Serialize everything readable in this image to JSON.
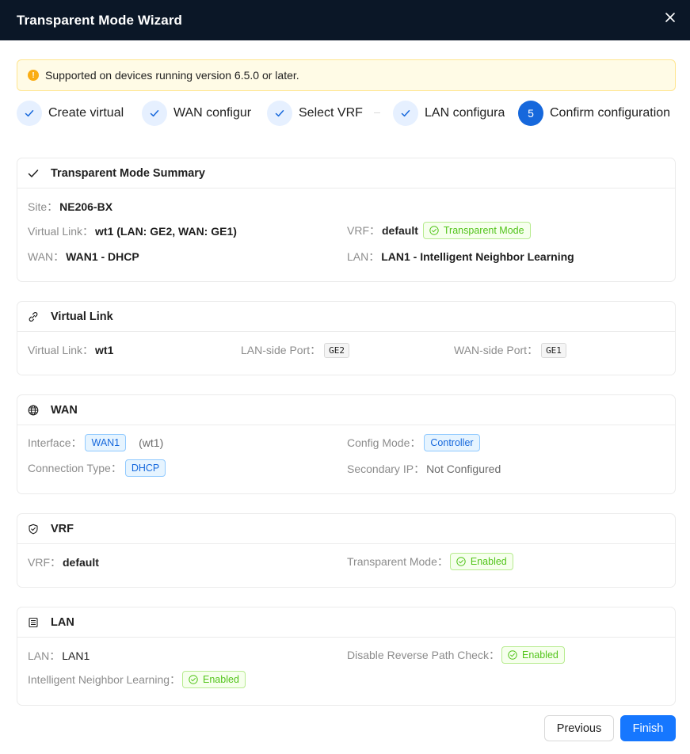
{
  "modal": {
    "title": "Transparent Mode Wizard"
  },
  "alert": {
    "text": "Supported on devices running version 6.5.0 or later."
  },
  "steps": [
    {
      "label": "Create virtual"
    },
    {
      "label": "WAN configur"
    },
    {
      "label": "Select VRF"
    },
    {
      "label": "LAN configura"
    },
    {
      "label": "Confirm configuration",
      "number": "5"
    }
  ],
  "summary": {
    "title": "Transparent Mode Summary",
    "site_label": "Site",
    "site_value": "NE206-BX",
    "vlink_label": "Virtual Link",
    "vlink_value": "wt1 (LAN: GE2, WAN: GE1)",
    "vrf_label": "VRF",
    "vrf_value": "default",
    "vrf_tag": "Transparent Mode",
    "wan_label": "WAN",
    "wan_value": "WAN1 - DHCP",
    "lan_label": "LAN",
    "lan_value": "LAN1 - Intelligent Neighbor Learning"
  },
  "virtual_link": {
    "title": "Virtual Link",
    "vlink_label": "Virtual Link",
    "vlink_value": "wt1",
    "lan_port_label": "LAN-side Port",
    "lan_port_value": "GE2",
    "wan_port_label": "WAN-side Port",
    "wan_port_value": "GE1"
  },
  "wan": {
    "title": "WAN",
    "interface_label": "Interface",
    "interface_value": "WAN1",
    "interface_note": "(wt1)",
    "config_mode_label": "Config Mode",
    "config_mode_value": "Controller",
    "conn_type_label": "Connection Type",
    "conn_type_value": "DHCP",
    "secondary_ip_label": "Secondary IP",
    "secondary_ip_value": "Not Configured"
  },
  "vrf": {
    "title": "VRF",
    "vrf_label": "VRF",
    "vrf_value": "default",
    "tmode_label": "Transparent Mode",
    "tmode_value": "Enabled"
  },
  "lan": {
    "title": "LAN",
    "lan_label": "LAN",
    "lan_value": "LAN1",
    "rpc_label": "Disable Reverse Path Check",
    "rpc_value": "Enabled",
    "inl_label": "Intelligent Neighbor Learning",
    "inl_value": "Enabled"
  },
  "buttons": {
    "previous": "Previous",
    "finish": "Finish"
  },
  "colors": {
    "header_bg": "#0b1727",
    "primary": "#1677ff",
    "success": "#52c41a",
    "warning": "#faad14"
  }
}
